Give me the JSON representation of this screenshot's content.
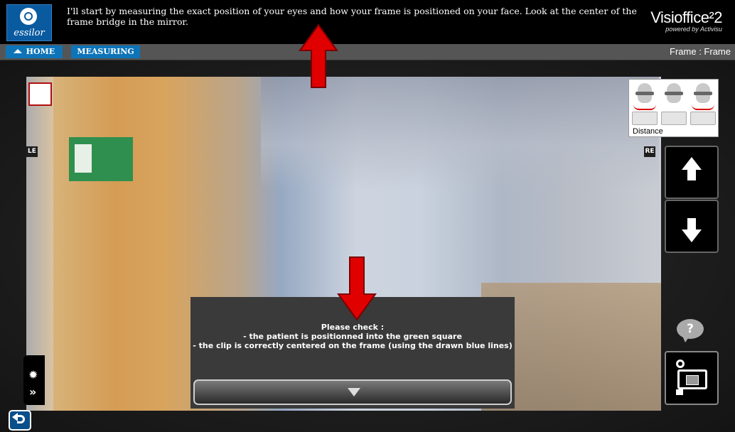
{
  "header": {
    "logo_text": "essilor",
    "instruction": "I'll start by measuring the exact position of your eyes and how your frame is positioned on your face. Look at the center of the frame bridge in the mirror.",
    "app_name": "Visioffice²2",
    "app_sub": "powered by Activisu"
  },
  "nav": {
    "home_label": "HOME",
    "measuring_label": "MEASURING",
    "frame_info": "Frame :  Frame"
  },
  "camera": {
    "left_eye_label": "LE",
    "right_eye_label": "RE"
  },
  "head_panel": {
    "distance_label": "Distance"
  },
  "help": {
    "label": "?"
  },
  "brightness": {
    "expand_label": "»"
  },
  "info_panel": {
    "line1": "Please check :",
    "line2": "- the patient is positionned into the green square",
    "line3": "- the clip is correctly centered on the frame (using the drawn blue lines)"
  },
  "colors": {
    "accent": "#0e74b8",
    "annotation": "#e00000",
    "top_bar": "#000000"
  }
}
